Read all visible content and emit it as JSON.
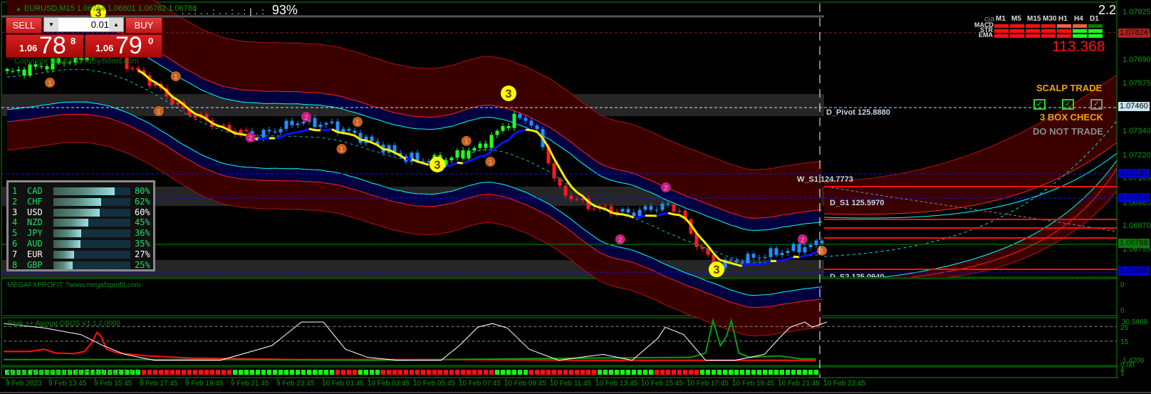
{
  "header": {
    "symbol_line": "EURUSD,M15  1.06764 1.06801 1.06762 1.06788",
    "progress_dots": ". . : . . : . . : . : | . :",
    "progress_percent": "93%",
    "copyright": "Copyright 2018 FXProSystems.com"
  },
  "trade_panel": {
    "sell_label": "SELL",
    "buy_label": "BUY",
    "lot_value": "0.01",
    "down_arrow": "▼",
    "up_arrow": "▲",
    "sell_price": {
      "prefix": "1.06",
      "main": "78",
      "sup": "8"
    },
    "buy_price": {
      "prefix": "1.06",
      "main": "79",
      "sup": "0"
    }
  },
  "currency_strength": [
    {
      "rank": "1",
      "currency": "CAD",
      "percent": 80,
      "percent_label": "80%",
      "color": "#1fe06a"
    },
    {
      "rank": "2",
      "currency": "CHF",
      "percent": 62,
      "percent_label": "62%",
      "color": "#1fe06a"
    },
    {
      "rank": "3",
      "currency": "USD",
      "percent": 60,
      "percent_label": "60%",
      "color": "#ffffff"
    },
    {
      "rank": "4",
      "currency": "NZD",
      "percent": 45,
      "percent_label": "45%",
      "color": "#1fe06a"
    },
    {
      "rank": "5",
      "currency": "JPY",
      "percent": 36,
      "percent_label": "36%",
      "color": "#1fe06a"
    },
    {
      "rank": "6",
      "currency": "AUD",
      "percent": 35,
      "percent_label": "35%",
      "color": "#1fe06a"
    },
    {
      "rank": "7",
      "currency": "EUR",
      "percent": 27,
      "percent_label": "27%",
      "color": "#ffffff"
    },
    {
      "rank": "8",
      "currency": "GBP",
      "percent": 25,
      "percent_label": "25%",
      "color": "#1fe06a"
    }
  ],
  "cja_panel": {
    "title": "cja",
    "spread": "2.2",
    "timeframes": [
      "M1",
      "M5",
      "M15",
      "M30",
      "H1",
      "H4",
      "D1"
    ],
    "rows": [
      {
        "label": "MACD",
        "colors": [
          "#ff1010",
          "#ff1010",
          "#ff1010",
          "#ff1010",
          "#f06048",
          "#f06048",
          "#0a7a0a"
        ]
      },
      {
        "label": "STR",
        "colors": [
          "#ff1010",
          "#ff1010",
          "#ff1010",
          "#ff1010",
          "#ff1010",
          "#22ff22",
          "#22ff22"
        ]
      },
      {
        "label": "EMA",
        "colors": [
          "#ff1010",
          "#ff1010",
          "#ff1010",
          "#ff1010",
          "#ff1010",
          "#22ff22",
          "#22ff22"
        ]
      }
    ],
    "value": "113.368"
  },
  "scalp": {
    "title": "SCALP TRADE",
    "checks": [
      {
        "state": "on"
      },
      {
        "state": "on"
      },
      {
        "state": "off"
      }
    ],
    "check_glyph": "✓",
    "subtitle": "3 BOX CHECK",
    "verdict": "DO NOT TRADE"
  },
  "pivots": {
    "d_pivot": "D_Pivot 125.8880",
    "w_s1": "W_S1 124.7773",
    "d_s1": "D_S1 125.5970",
    "d_s2": "D_S2 125.0940"
  },
  "price_axis": {
    "ticks": [
      "1.07925",
      "1.07810",
      "1.07690",
      "1.07575",
      "1.07340",
      "1.07220",
      "1.07105",
      "1.06985",
      "1.06870",
      "1.06755"
    ],
    "tags": [
      {
        "value": "1.07824",
        "bg": "#b02020",
        "fg": "#300000"
      },
      {
        "value": "1.07460",
        "bg": "#c8e4f0",
        "fg": "#000000"
      },
      {
        "value": "1.07131",
        "bg": "#0000dd",
        "fg": "#000030"
      },
      {
        "value": "1.07013",
        "bg": "#0000dd",
        "fg": "#000030"
      },
      {
        "value": "1.06788",
        "bg": "#0a7a0a",
        "fg": "#002000"
      },
      {
        "value": "1.06649",
        "bg": "#0000dd",
        "fg": "#000030"
      }
    ]
  },
  "indicators": {
    "megafx_label": "MEGAFXPROFIT ?www.megafxprofit.com",
    "megafx_axis": [
      "0",
      "0"
    ],
    "obos_label": "Peak ++ Agimat OBOS V1.1 2.0000",
    "obos_axis": [
      "30.5868",
      "25",
      "15",
      "1.4206",
      "0.00"
    ],
    "marketwatch_label": "Agimat MarketWatch EURUSD M15 3 0 0",
    "marketwatch_axis": [
      "4",
      "1"
    ],
    "marketwatch_signals": "GGGGGGGGGGGGGGGGGGGGGGGGRRRRRRRRRRRRRRRRGGGGGGGGGGGGGGGGGGRRRRGGGGRRRRRRRRRRRRRRRRRRRRGGGGGGRRRRRRRRRRRRGGGGGGGGGGRRRRRRRRGGGGGGGGGGGGGGGGGGGGG"
  },
  "time_axis": [
    "9 Feb 2023",
    "9 Feb 13:45",
    "9 Feb 15:45",
    "9 Feb 17:45",
    "9 Feb 19:45",
    "9 Feb 21:45",
    "9 Feb 23:45",
    "10 Feb 01:45",
    "10 Feb 03:45",
    "10 Feb 05:45",
    "10 Feb 07:45",
    "10 Feb 09:45",
    "10 Feb 11:45",
    "10 Feb 13:45",
    "10 Feb 15:45",
    "10 Feb 17:45",
    "10 Feb 19:45",
    "10 Feb 21:45",
    "10 Feb 23:45"
  ],
  "price_path": {
    "bars": 144,
    "keypoints": [
      [
        0,
        1.07626
      ],
      [
        18,
        1.07735
      ],
      [
        25,
        1.07589
      ],
      [
        31,
        1.07444
      ],
      [
        38,
        1.07354
      ],
      [
        44,
        1.07318
      ],
      [
        51,
        1.0739
      ],
      [
        57,
        1.07372
      ],
      [
        63,
        1.07299
      ],
      [
        70,
        1.07209
      ],
      [
        76,
        1.07191
      ],
      [
        83,
        1.07264
      ],
      [
        89,
        1.07408
      ],
      [
        92,
        1.0739
      ],
      [
        94,
        1.07264
      ],
      [
        97,
        1.07047
      ],
      [
        102,
        1.06973
      ],
      [
        109,
        1.06937
      ],
      [
        115,
        1.06973
      ],
      [
        118,
        1.06955
      ],
      [
        120,
        1.06829
      ],
      [
        124,
        1.06683
      ],
      [
        128,
        1.06701
      ],
      [
        134,
        1.06737
      ],
      [
        143,
        1.06788
      ]
    ]
  },
  "markers": [
    {
      "label": "3",
      "kind": "yellow",
      "bar": 16,
      "price": 1.07927
    },
    {
      "label": "3",
      "kind": "yellow",
      "bar": 88,
      "price": 1.07528
    },
    {
      "label": "3",
      "kind": "yellow",
      "bar": 75.5,
      "price": 1.07177
    },
    {
      "label": "3",
      "kind": "yellow",
      "bar": 124.5,
      "price": 1.0666
    },
    {
      "label": "1",
      "kind": "orange",
      "bar": 7.5,
      "price": 1.07581
    },
    {
      "label": "1",
      "kind": "orange",
      "bar": 29.6,
      "price": 1.07612
    },
    {
      "label": "1",
      "kind": "orange",
      "bar": 26.6,
      "price": 1.0744
    },
    {
      "label": "1",
      "kind": "orange",
      "bar": 58.7,
      "price": 1.07254
    },
    {
      "label": "1",
      "kind": "orange",
      "bar": 61.5,
      "price": 1.07387
    },
    {
      "label": "1",
      "kind": "orange",
      "bar": 80.6,
      "price": 1.07293
    },
    {
      "label": "1",
      "kind": "orange",
      "bar": 84.8,
      "price": 1.07191
    },
    {
      "label": "1",
      "kind": "orange",
      "bar": 143,
      "price": 1.06752
    },
    {
      "label": "2",
      "kind": "magenta",
      "bar": 52.5,
      "price": 1.07412
    },
    {
      "label": "2",
      "kind": "magenta",
      "bar": 42.7,
      "price": 1.0731
    },
    {
      "label": "2",
      "kind": "magenta",
      "bar": 115.6,
      "price": 1.07064
    },
    {
      "label": "2",
      "kind": "magenta",
      "bar": 107.6,
      "price": 1.06808
    },
    {
      "label": "2",
      "kind": "magenta",
      "bar": 139.6,
      "price": 1.06808
    }
  ],
  "colors": {
    "frame": "#0a8a0a",
    "bull": "#1e90ff",
    "bear_red": "#ff1a1a",
    "up_green": "#22ff22",
    "ma_down": "#ffee00",
    "ma_up": "#1010ff"
  }
}
